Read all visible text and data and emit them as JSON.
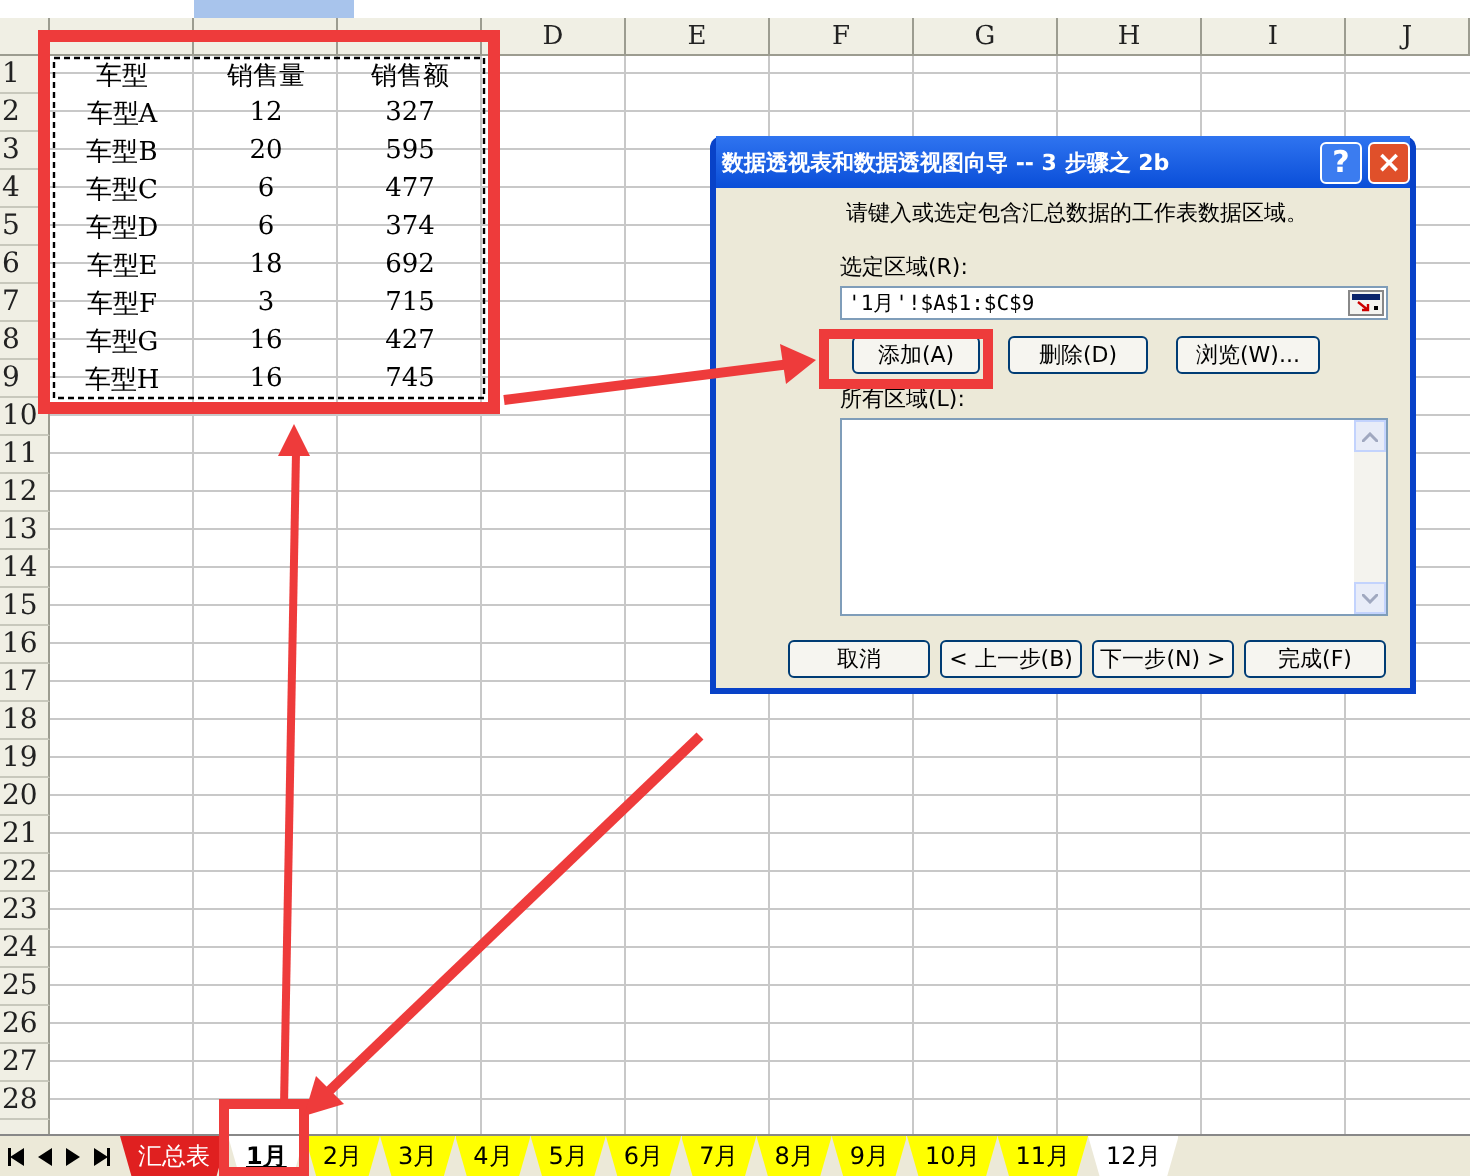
{
  "sheet": {
    "columns": [
      "",
      "",
      "",
      "D",
      "E",
      "F",
      "G",
      "H",
      "I",
      "J"
    ],
    "row_numbers": [
      "1",
      "2",
      "3",
      "4",
      "5",
      "6",
      "7",
      "8",
      "9",
      "10",
      "11",
      "12",
      "13",
      "14",
      "15",
      "16",
      "17",
      "18",
      "19",
      "20",
      "21",
      "22",
      "23",
      "24",
      "25",
      "26",
      "27",
      "28"
    ],
    "cells": [
      [
        "车型",
        "销售量",
        "销售额"
      ],
      [
        "车型A",
        "12",
        "327"
      ],
      [
        "车型B",
        "20",
        "595"
      ],
      [
        "车型C",
        "6",
        "477"
      ],
      [
        "车型D",
        "6",
        "374"
      ],
      [
        "车型E",
        "18",
        "692"
      ],
      [
        "车型F",
        "3",
        "715"
      ],
      [
        "车型G",
        "16",
        "427"
      ],
      [
        "车型H",
        "16",
        "745"
      ]
    ]
  },
  "sheet_tabs": [
    {
      "label": "汇总表",
      "selected": false,
      "color": "#e02020"
    },
    {
      "label": "1月",
      "selected": true,
      "color": "#ffffff"
    },
    {
      "label": "2月",
      "selected": false,
      "color": "#ffff00"
    },
    {
      "label": "3月",
      "selected": false,
      "color": "#ffff00"
    },
    {
      "label": "4月",
      "selected": false,
      "color": "#ffff00"
    },
    {
      "label": "5月",
      "selected": false,
      "color": "#ffff00"
    },
    {
      "label": "6月",
      "selected": false,
      "color": "#ffff00"
    },
    {
      "label": "7月",
      "selected": false,
      "color": "#ffff00"
    },
    {
      "label": "8月",
      "selected": false,
      "color": "#ffff00"
    },
    {
      "label": "9月",
      "selected": false,
      "color": "#ffff00"
    },
    {
      "label": "10月",
      "selected": false,
      "color": "#ffff00"
    },
    {
      "label": "11月",
      "selected": false,
      "color": "#ffff00"
    },
    {
      "label": "12月",
      "selected": false,
      "color": "#ffffff"
    }
  ],
  "dialog": {
    "title": "数据透视表和数据透视图向导 -- 3 步骤之 2b",
    "help": "?",
    "close": "×",
    "prompt": "请键入或选定包含汇总数据的工作表数据区域。",
    "range_label": "选定区域(R):",
    "range_value": "'1月'!$A$1:$C$9",
    "range_buttons": [
      "添加(A)",
      "删除(D)",
      "浏览(W)..."
    ],
    "all_ranges_label": "所有区域(L):",
    "footer_buttons": [
      "取消",
      "< 上一步(B)",
      "下一步(N) >",
      "完成(F)"
    ]
  }
}
